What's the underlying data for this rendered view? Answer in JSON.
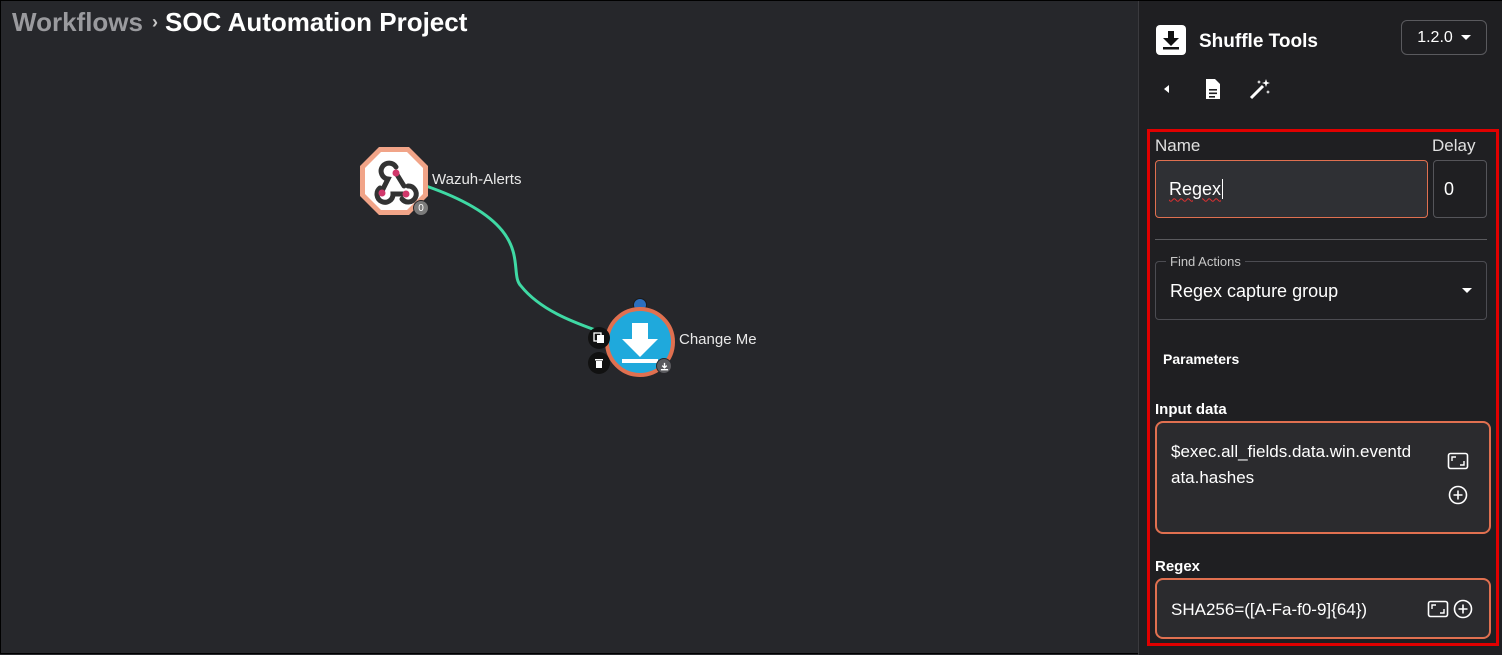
{
  "breadcrumb": {
    "root": "Workflows",
    "separator": "›",
    "current": "SOC Automation Project"
  },
  "canvas": {
    "trigger_node": {
      "label": "Wazuh-Alerts",
      "badge": "0",
      "icon": "webhook-icon"
    },
    "action_node": {
      "label": "Change Me",
      "icon": "download-icon"
    },
    "edge_color": "#3fd9a4"
  },
  "panel": {
    "app_name": "Shuffle Tools",
    "version": "1.2.0",
    "tools": [
      "chevron-left-icon",
      "document-icon",
      "magic-wand-icon"
    ],
    "name_label": "Name",
    "name_value": "Regex",
    "delay_label": "Delay",
    "delay_value": "0",
    "action_select": {
      "legend": "Find Actions",
      "value": "Regex capture group"
    },
    "parameters_heading": "Parameters",
    "input_data": {
      "label": "Input data",
      "line1": "$exec.all_fields.data.win.eventd",
      "line2": "ata.hashes"
    },
    "regex": {
      "label": "Regex",
      "value": "SHA256=([A-Fa-f0-9]{64})"
    }
  },
  "colors": {
    "accent": "#e07050",
    "highlight": "#e00000",
    "node_blue": "#1fa9dc",
    "background": "#26272b"
  }
}
